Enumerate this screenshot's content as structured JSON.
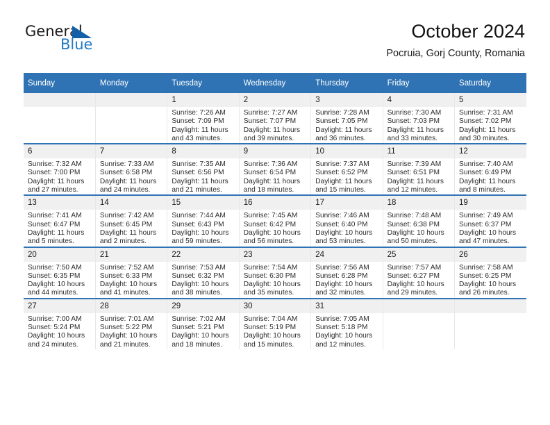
{
  "logo": {
    "word_one": "General",
    "word_two": "Blue",
    "triangle_color": "#1460a8",
    "blue_text_color": "#1f7ac4",
    "icon": "triangle-logo-icon"
  },
  "header": {
    "title": "October 2024",
    "location": "Pocruia, Gorj County, Romania"
  },
  "theme": {
    "header_blue": "#2f73b4",
    "daynum_band": "#f0f0f0",
    "row_divider": "#2f73b4",
    "cell_divider": "#e8e8e8",
    "page_background": "#ffffff"
  },
  "calendar": {
    "weekday_headers": [
      "Sunday",
      "Monday",
      "Tuesday",
      "Wednesday",
      "Thursday",
      "Friday",
      "Saturday"
    ],
    "labels": {
      "sunrise_prefix": "Sunrise:",
      "sunset_prefix": "Sunset:",
      "daylight_prefix": "Daylight:"
    },
    "weeks": [
      [
        {
          "day": "",
          "empty": true
        },
        {
          "day": "",
          "empty": true
        },
        {
          "day": "1",
          "sunrise": "Sunrise: 7:26 AM",
          "sunset": "Sunset: 7:09 PM",
          "daylight": "Daylight: 11 hours and 43 minutes."
        },
        {
          "day": "2",
          "sunrise": "Sunrise: 7:27 AM",
          "sunset": "Sunset: 7:07 PM",
          "daylight": "Daylight: 11 hours and 39 minutes."
        },
        {
          "day": "3",
          "sunrise": "Sunrise: 7:28 AM",
          "sunset": "Sunset: 7:05 PM",
          "daylight": "Daylight: 11 hours and 36 minutes."
        },
        {
          "day": "4",
          "sunrise": "Sunrise: 7:30 AM",
          "sunset": "Sunset: 7:03 PM",
          "daylight": "Daylight: 11 hours and 33 minutes."
        },
        {
          "day": "5",
          "sunrise": "Sunrise: 7:31 AM",
          "sunset": "Sunset: 7:02 PM",
          "daylight": "Daylight: 11 hours and 30 minutes."
        }
      ],
      [
        {
          "day": "6",
          "sunrise": "Sunrise: 7:32 AM",
          "sunset": "Sunset: 7:00 PM",
          "daylight": "Daylight: 11 hours and 27 minutes."
        },
        {
          "day": "7",
          "sunrise": "Sunrise: 7:33 AM",
          "sunset": "Sunset: 6:58 PM",
          "daylight": "Daylight: 11 hours and 24 minutes."
        },
        {
          "day": "8",
          "sunrise": "Sunrise: 7:35 AM",
          "sunset": "Sunset: 6:56 PM",
          "daylight": "Daylight: 11 hours and 21 minutes."
        },
        {
          "day": "9",
          "sunrise": "Sunrise: 7:36 AM",
          "sunset": "Sunset: 6:54 PM",
          "daylight": "Daylight: 11 hours and 18 minutes."
        },
        {
          "day": "10",
          "sunrise": "Sunrise: 7:37 AM",
          "sunset": "Sunset: 6:52 PM",
          "daylight": "Daylight: 11 hours and 15 minutes."
        },
        {
          "day": "11",
          "sunrise": "Sunrise: 7:39 AM",
          "sunset": "Sunset: 6:51 PM",
          "daylight": "Daylight: 11 hours and 12 minutes."
        },
        {
          "day": "12",
          "sunrise": "Sunrise: 7:40 AM",
          "sunset": "Sunset: 6:49 PM",
          "daylight": "Daylight: 11 hours and 8 minutes."
        }
      ],
      [
        {
          "day": "13",
          "sunrise": "Sunrise: 7:41 AM",
          "sunset": "Sunset: 6:47 PM",
          "daylight": "Daylight: 11 hours and 5 minutes."
        },
        {
          "day": "14",
          "sunrise": "Sunrise: 7:42 AM",
          "sunset": "Sunset: 6:45 PM",
          "daylight": "Daylight: 11 hours and 2 minutes."
        },
        {
          "day": "15",
          "sunrise": "Sunrise: 7:44 AM",
          "sunset": "Sunset: 6:43 PM",
          "daylight": "Daylight: 10 hours and 59 minutes."
        },
        {
          "day": "16",
          "sunrise": "Sunrise: 7:45 AM",
          "sunset": "Sunset: 6:42 PM",
          "daylight": "Daylight: 10 hours and 56 minutes."
        },
        {
          "day": "17",
          "sunrise": "Sunrise: 7:46 AM",
          "sunset": "Sunset: 6:40 PM",
          "daylight": "Daylight: 10 hours and 53 minutes."
        },
        {
          "day": "18",
          "sunrise": "Sunrise: 7:48 AM",
          "sunset": "Sunset: 6:38 PM",
          "daylight": "Daylight: 10 hours and 50 minutes."
        },
        {
          "day": "19",
          "sunrise": "Sunrise: 7:49 AM",
          "sunset": "Sunset: 6:37 PM",
          "daylight": "Daylight: 10 hours and 47 minutes."
        }
      ],
      [
        {
          "day": "20",
          "sunrise": "Sunrise: 7:50 AM",
          "sunset": "Sunset: 6:35 PM",
          "daylight": "Daylight: 10 hours and 44 minutes."
        },
        {
          "day": "21",
          "sunrise": "Sunrise: 7:52 AM",
          "sunset": "Sunset: 6:33 PM",
          "daylight": "Daylight: 10 hours and 41 minutes."
        },
        {
          "day": "22",
          "sunrise": "Sunrise: 7:53 AM",
          "sunset": "Sunset: 6:32 PM",
          "daylight": "Daylight: 10 hours and 38 minutes."
        },
        {
          "day": "23",
          "sunrise": "Sunrise: 7:54 AM",
          "sunset": "Sunset: 6:30 PM",
          "daylight": "Daylight: 10 hours and 35 minutes."
        },
        {
          "day": "24",
          "sunrise": "Sunrise: 7:56 AM",
          "sunset": "Sunset: 6:28 PM",
          "daylight": "Daylight: 10 hours and 32 minutes."
        },
        {
          "day": "25",
          "sunrise": "Sunrise: 7:57 AM",
          "sunset": "Sunset: 6:27 PM",
          "daylight": "Daylight: 10 hours and 29 minutes."
        },
        {
          "day": "26",
          "sunrise": "Sunrise: 7:58 AM",
          "sunset": "Sunset: 6:25 PM",
          "daylight": "Daylight: 10 hours and 26 minutes."
        }
      ],
      [
        {
          "day": "27",
          "sunrise": "Sunrise: 7:00 AM",
          "sunset": "Sunset: 5:24 PM",
          "daylight": "Daylight: 10 hours and 24 minutes."
        },
        {
          "day": "28",
          "sunrise": "Sunrise: 7:01 AM",
          "sunset": "Sunset: 5:22 PM",
          "daylight": "Daylight: 10 hours and 21 minutes."
        },
        {
          "day": "29",
          "sunrise": "Sunrise: 7:02 AM",
          "sunset": "Sunset: 5:21 PM",
          "daylight": "Daylight: 10 hours and 18 minutes."
        },
        {
          "day": "30",
          "sunrise": "Sunrise: 7:04 AM",
          "sunset": "Sunset: 5:19 PM",
          "daylight": "Daylight: 10 hours and 15 minutes."
        },
        {
          "day": "31",
          "sunrise": "Sunrise: 7:05 AM",
          "sunset": "Sunset: 5:18 PM",
          "daylight": "Daylight: 10 hours and 12 minutes."
        },
        {
          "day": "",
          "empty": true
        },
        {
          "day": "",
          "empty": true
        }
      ]
    ]
  }
}
